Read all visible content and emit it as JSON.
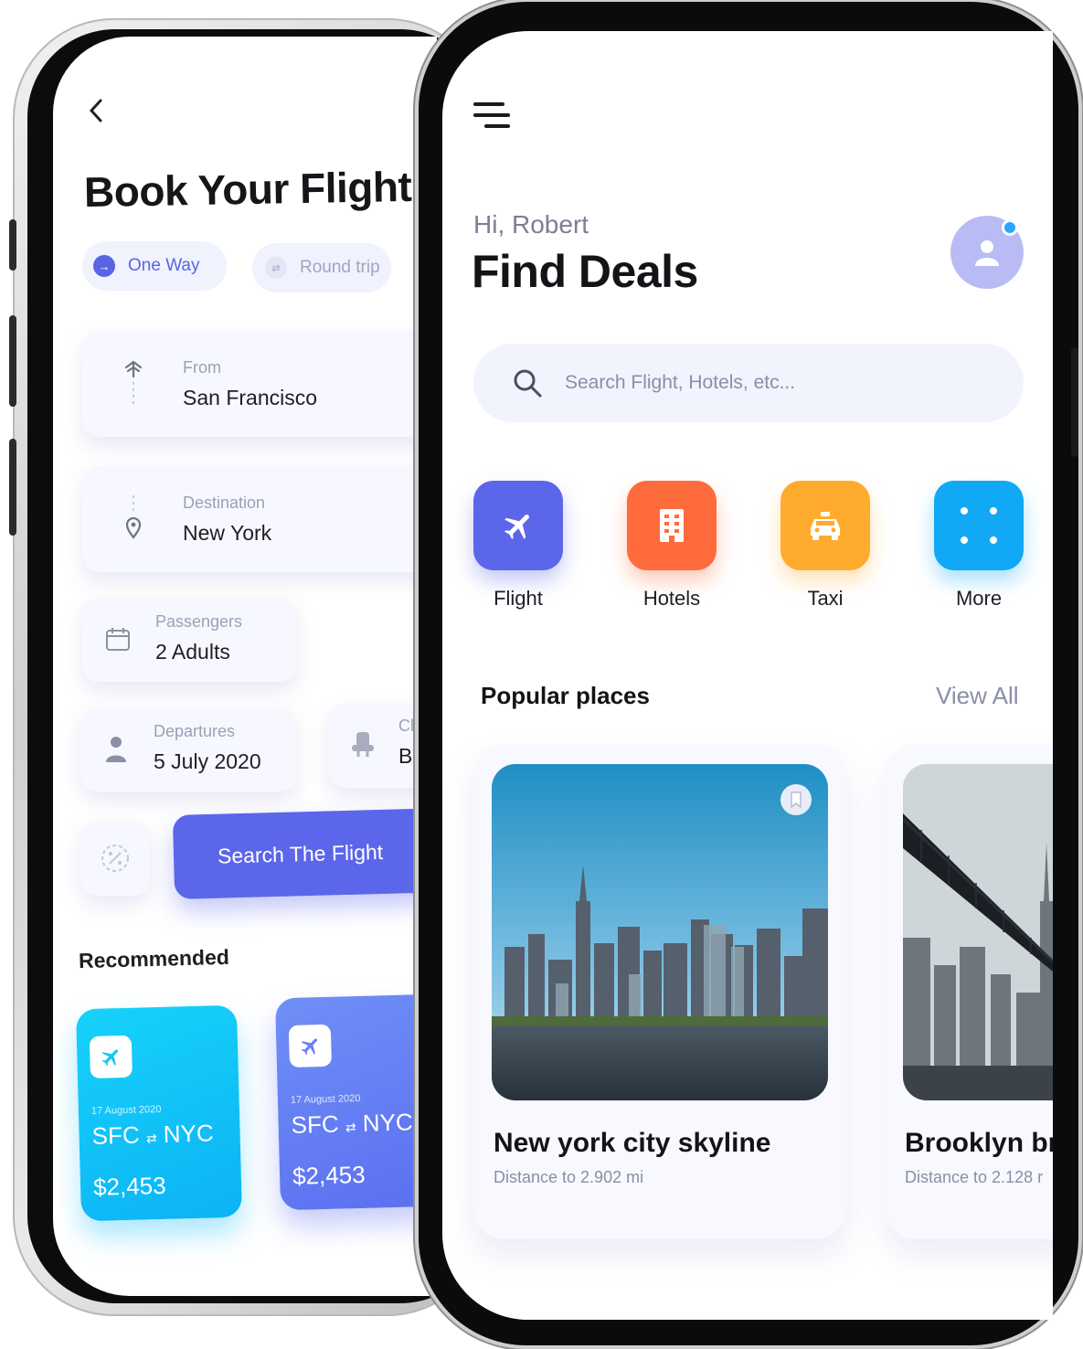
{
  "back_screen": {
    "back_label": "‹",
    "title": "Book Your Flight",
    "trip_types": [
      {
        "label": "One Way",
        "icon": "arrow-right-icon",
        "selected": true
      },
      {
        "label": "Round trip",
        "icon": "swap-icon",
        "selected": false
      }
    ],
    "from": {
      "label": "From",
      "value": "San Francisco",
      "icon": "departure-pin-icon"
    },
    "destination": {
      "label": "Destination",
      "value": "New York",
      "icon": "location-pin-icon"
    },
    "passengers": {
      "label": "Passengers",
      "value": "2 Adults",
      "icon": "calendar-icon"
    },
    "departures": {
      "label": "Departures",
      "value": "5 July 2020",
      "icon": "person-icon"
    },
    "class": {
      "label": "Cl",
      "value": "Bu",
      "icon": "seat-icon"
    },
    "promo_icon": "percent-icon",
    "search_button": "Search The Flight",
    "recommended_title": "Recommended",
    "recommended": [
      {
        "date": "17 August 2020",
        "from": "SFC",
        "to": "NYC",
        "arrow": "⇄",
        "price": "$2,453",
        "color": "#12c6f9",
        "icon": "plane-icon"
      },
      {
        "date": "17 August 2020",
        "from": "SFC",
        "to": "NYC",
        "arrow": "⇄",
        "price": "$2,453",
        "color": "#6a7ff4",
        "icon": "plane-icon"
      }
    ]
  },
  "front_screen": {
    "menu_icon": "menu-icon",
    "greeting": "Hi, Robert",
    "title": "Find Deals",
    "avatar_icon": "user-icon",
    "search_placeholder": "Search Flight, Hotels, etc...",
    "categories": [
      {
        "label": "Flight",
        "icon": "plane-icon",
        "color": "#5b66ea"
      },
      {
        "label": "Hotels",
        "icon": "building-icon",
        "color": "#ff6b3d"
      },
      {
        "label": "Taxi",
        "icon": "taxi-icon",
        "color": "#ffab2e"
      },
      {
        "label": "More",
        "icon": "grid-dots-icon",
        "color": "#11a8f5"
      }
    ],
    "popular_title": "Popular places",
    "view_all": "View All",
    "places": [
      {
        "name": "New york city skyline",
        "distance": "Distance to 2.902 mi",
        "icon": "bookmark-icon"
      },
      {
        "name": "Brooklyn br",
        "distance": "Distance to 2.128 r"
      }
    ]
  }
}
